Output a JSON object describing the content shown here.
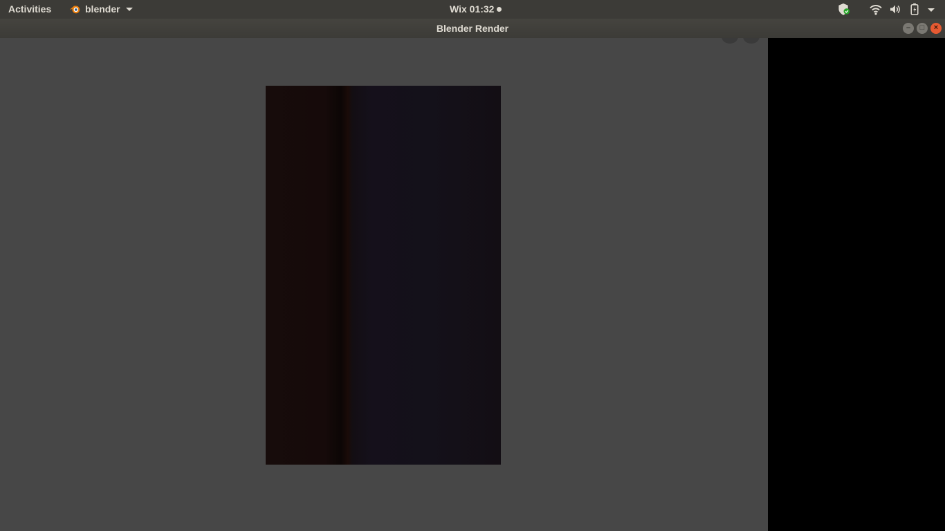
{
  "topbar": {
    "activities_label": "Activities",
    "app_name": "blender",
    "clock": "Wix 01:32",
    "tray_icons": [
      "security-shield-icon",
      "wifi-icon",
      "volume-icon",
      "battery-icon",
      "system-menu-arrow-icon"
    ]
  },
  "window": {
    "title": "Blender Render",
    "buttons": [
      "minimize",
      "maximize",
      "close"
    ]
  },
  "render": {
    "background_color": "#474747"
  },
  "colors": {
    "topbar_bg": "#3c3b37",
    "topbar_text": "#dfdbd2",
    "close_button": "#e75a32",
    "blender_orange": "#e87d0d"
  }
}
